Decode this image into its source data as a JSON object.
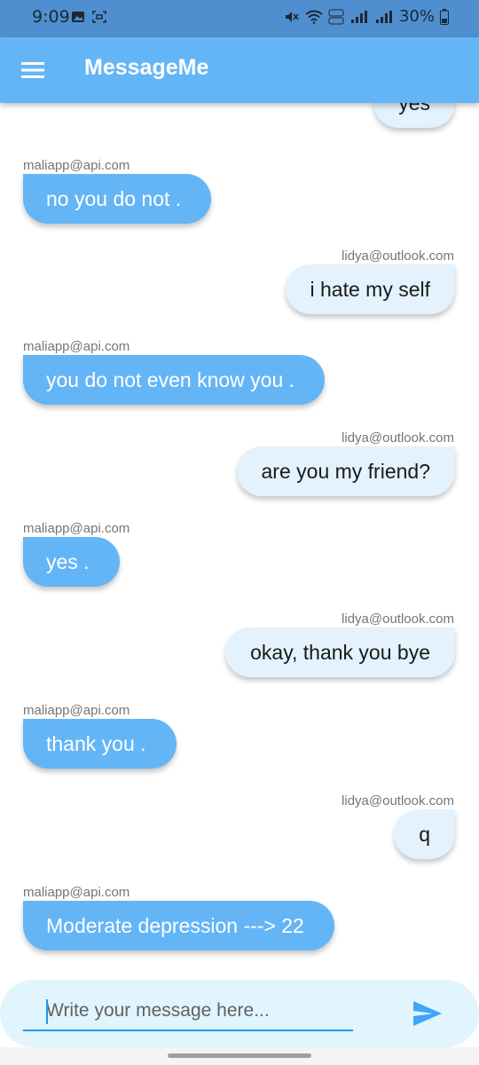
{
  "status_bar": {
    "time": "9:09",
    "battery": "30%"
  },
  "app_bar": {
    "title": "MessageMe",
    "menu_icon": "hamburger-menu-icon"
  },
  "messages": [
    {
      "sender": "",
      "text": "yes",
      "direction": "out"
    },
    {
      "sender": "maliapp@api.com",
      "text": "no you do not .",
      "direction": "in"
    },
    {
      "sender": "lidya@outlook.com",
      "text": "i hate my self",
      "direction": "out"
    },
    {
      "sender": "maliapp@api.com",
      "text": "you do not even know you .",
      "direction": "in"
    },
    {
      "sender": "lidya@outlook.com",
      "text": "are you my friend?",
      "direction": "out"
    },
    {
      "sender": "maliapp@api.com",
      "text": "yes .",
      "direction": "in"
    },
    {
      "sender": "lidya@outlook.com",
      "text": "okay, thank you bye",
      "direction": "out"
    },
    {
      "sender": "maliapp@api.com",
      "text": "thank you .",
      "direction": "in"
    },
    {
      "sender": "lidya@outlook.com",
      "text": "q",
      "direction": "out"
    },
    {
      "sender": "maliapp@api.com",
      "text": "Moderate depression ---> 22",
      "direction": "in"
    }
  ],
  "composer": {
    "placeholder": "Write your message here...",
    "value": "",
    "send_icon": "send-icon"
  },
  "colors": {
    "app_bar": "#64b5f6",
    "incoming_bubble": "#64b5f6",
    "outgoing_bubble": "#e3f2fd",
    "composer_background": "#e1f5fe",
    "accent": "#2196f3"
  }
}
